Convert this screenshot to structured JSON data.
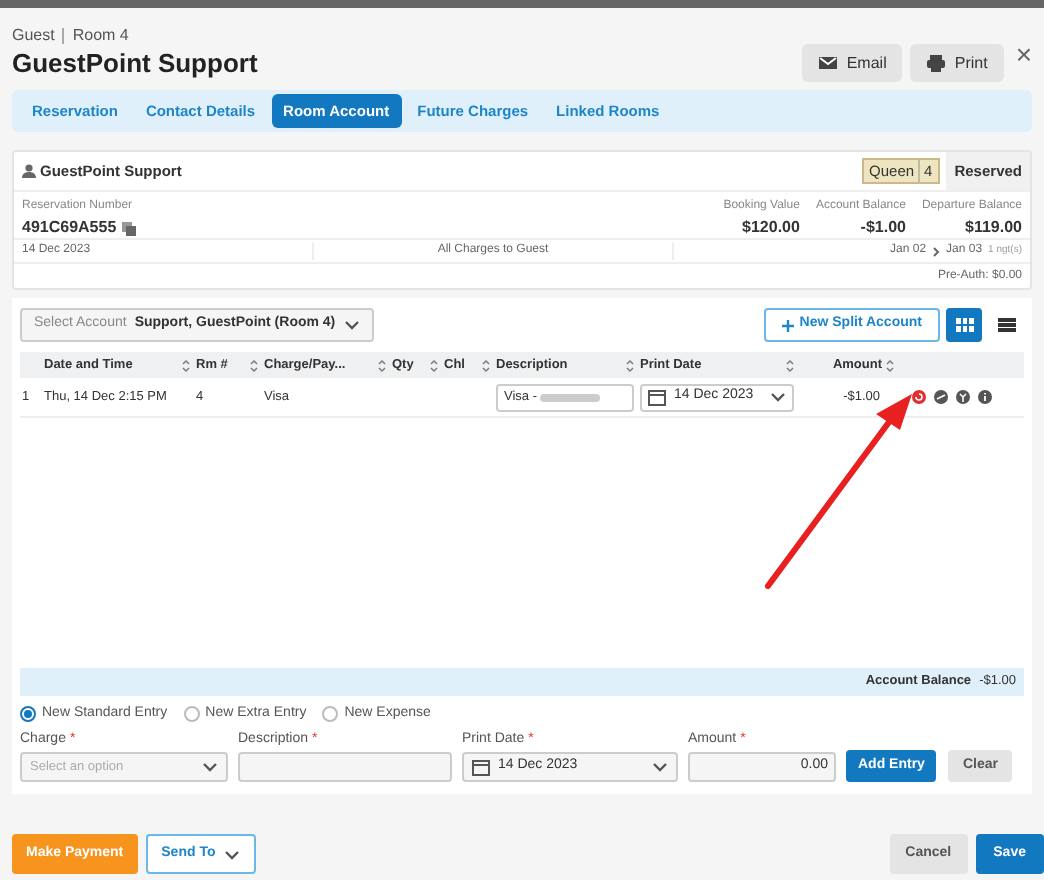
{
  "header": {
    "breadcrumb": [
      "Guest",
      "Room 4"
    ],
    "title": "GuestPoint Support",
    "buttons": [
      {
        "kind": "email",
        "label": "Email"
      },
      {
        "kind": "print",
        "label": "Print"
      }
    ],
    "close": "×"
  },
  "tabs": [
    {
      "label": "Reservation",
      "selected": false
    },
    {
      "label": "Contact Details",
      "selected": false
    },
    {
      "label": "Room Account",
      "selected": true
    },
    {
      "label": "Future Charges",
      "selected": false
    },
    {
      "label": "Linked Rooms",
      "selected": false
    }
  ],
  "summary": {
    "guest": "GuestPoint Support",
    "room_type": "Queen",
    "room_number": "4",
    "status": "Reserved",
    "reservation_label": "Reservation Number",
    "reservation_number": "491C69A555",
    "figures": [
      {
        "label": "Booking Value",
        "value": "$120.00"
      },
      {
        "label": "Account Balance",
        "value": "-$1.00"
      },
      {
        "label": "Departure Balance",
        "value": "$119.00"
      }
    ],
    "date": "14 Dec 2023",
    "billing": "All Charges to Guest",
    "arrival": "Jan 02",
    "departure": "Jan 03",
    "nights": "1 ngt(s)",
    "pre_auth": "Pre-Auth: $0.00"
  },
  "account": {
    "label": "Select Account",
    "value": "Support, GuestPoint (Room 4)",
    "new_split": "New Split Account",
    "views": [
      {
        "kind": "grid",
        "selected": true
      },
      {
        "kind": "list",
        "selected": false
      }
    ]
  },
  "table": {
    "columns": [
      "Date and Time",
      "Rm #",
      "Charge/Pay...",
      "Qty",
      "Chl",
      "Description",
      "Print Date",
      "Amount"
    ],
    "rows": [
      {
        "index": "1",
        "date_time": "Thu, 14 Dec 2:15 PM",
        "room": "4",
        "charge": "Visa",
        "qty": "",
        "chl": "",
        "description": "Visa - ",
        "print_date": "14 Dec 2023",
        "amount": "-$1.00"
      }
    ],
    "balance_label": "Account Balance",
    "balance": "-$1.00"
  },
  "entry": {
    "types": [
      {
        "label": "New Standard Entry",
        "selected": true
      },
      {
        "label": "New Extra Entry",
        "selected": false
      },
      {
        "label": "New Expense",
        "selected": false
      }
    ],
    "charge": {
      "label": "Charge",
      "required": "*",
      "placeholder": "Select an option"
    },
    "description": {
      "label": "Description",
      "required": "*"
    },
    "print_date": {
      "label": "Print Date",
      "required": "*",
      "value": "14 Dec 2023"
    },
    "amount": {
      "label": "Amount",
      "required": "*",
      "value": "0.00"
    },
    "add": "Add Entry",
    "clear": "Clear"
  },
  "footer": {
    "make_payment": "Make Payment",
    "send_to": "Send To",
    "cancel": "Cancel",
    "save": "Save"
  }
}
